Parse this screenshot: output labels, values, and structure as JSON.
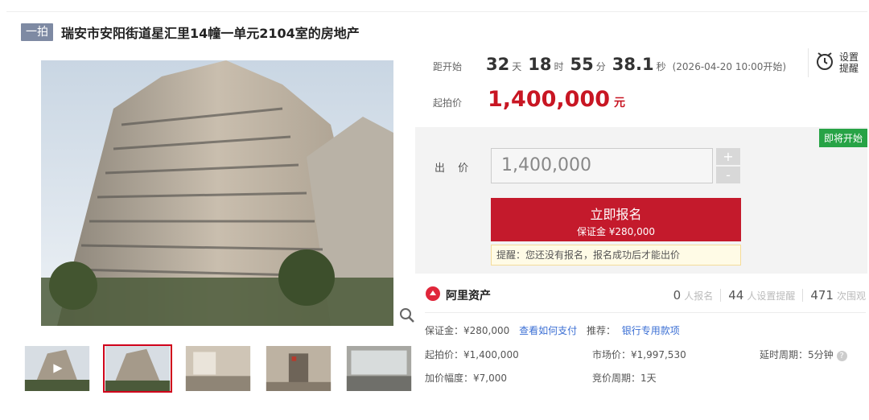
{
  "header": {
    "badge": "一拍",
    "title": "瑞安市安阳街道星汇里14幢一单元2104室的房地产"
  },
  "countdown": {
    "label": "距开始",
    "days": "32",
    "days_unit": "天",
    "hours": "18",
    "hours_unit": "时",
    "minutes": "55",
    "minutes_unit": "分",
    "seconds": "38.1",
    "seconds_unit": "秒",
    "start_time": "(2026-04-20 10:00开始)"
  },
  "remind": {
    "icon": "alarm-clock-icon",
    "label": "设置提醒"
  },
  "start_price": {
    "label": "起拍价",
    "value": "1,400,000",
    "unit": "元"
  },
  "bid": {
    "status_tag": "即将开始",
    "label": "出 价",
    "input_value": "1,400,000",
    "plus": "+",
    "minus": "-",
    "signup_label": "立即报名",
    "signup_deposit": "保证金 ¥280,000",
    "tip": "提醒：您还没有报名，报名成功后才能出价"
  },
  "brand": {
    "name": "阿里资产",
    "enrolled_count": "0",
    "enrolled_label": "人报名",
    "remind_count": "44",
    "remind_label": "人设置提醒",
    "view_count": "471",
    "view_label": "次围观"
  },
  "details": {
    "deposit": "保证金：¥280,000",
    "how_to_pay": "查看如何支付",
    "recommend_label": "推荐：",
    "recommend_link": "银行专用款项",
    "start_price": "起拍价：¥1,400,000",
    "market_price": "市场价：¥1,997,530",
    "delay_period": "延时周期：5分钟",
    "increment": "加价幅度：¥7,000",
    "bid_period": "竞价周期：1天"
  },
  "colors": {
    "accent_red": "#c41a2c",
    "badge": "#7e8aa3",
    "link": "#3b6fd4",
    "tag_green": "#27a346"
  }
}
